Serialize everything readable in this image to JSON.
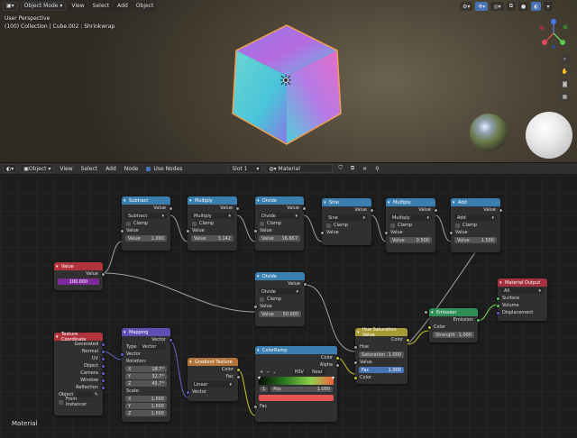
{
  "viewport": {
    "mode": "Object Mode",
    "menus": [
      "View",
      "Select",
      "Add",
      "Object"
    ],
    "info_line1": "User Perspective",
    "info_line2": "(100) Collection | Cube.002 : Shrinkwrap"
  },
  "node_editor": {
    "object_label": "Object",
    "menus": [
      "View",
      "Select",
      "Add",
      "Node"
    ],
    "use_nodes": "Use Nodes",
    "slot": "Slot 1",
    "material": "Material",
    "footer": "Material"
  },
  "nodes": {
    "subtract": {
      "title": "Subtract",
      "out": "Value",
      "op": "Subtract",
      "clamp": "Clamp",
      "in": "Value",
      "field": "Value",
      "val": "1.000"
    },
    "multiply1": {
      "title": "Multiply",
      "out": "Value",
      "op": "Multiply",
      "clamp": "Clamp",
      "in": "Value",
      "field": "Value",
      "val": "3.142"
    },
    "divide1": {
      "title": "Divide",
      "out": "Value",
      "op": "Divide",
      "clamp": "Clamp",
      "in": "Value",
      "field": "Value",
      "val": "16.667"
    },
    "sine": {
      "title": "Sine",
      "out": "Value",
      "op": "Sine",
      "clamp": "Clamp",
      "in": "Value"
    },
    "multiply2": {
      "title": "Multiply",
      "out": "Value",
      "op": "Multiply",
      "clamp": "Clamp",
      "in": "Value",
      "field": "Value",
      "val": "0.500"
    },
    "add": {
      "title": "Add",
      "out": "Value",
      "op": "Add",
      "clamp": "Clamp",
      "in": "Value",
      "field": "Value",
      "val": "1.500"
    },
    "value": {
      "title": "Value",
      "out": "Value",
      "val": "100.000"
    },
    "divide2": {
      "title": "Divide",
      "out": "Value",
      "op": "Divide",
      "clamp": "Clamp",
      "in": "Value",
      "field": "Value",
      "val": "50.000"
    },
    "material_output": {
      "title": "Material Output",
      "target": "All",
      "surface": "Surface",
      "volume": "Volume",
      "displacement": "Displacement"
    },
    "emission": {
      "title": "Emission",
      "out": "Emission",
      "color": "Color",
      "strength": "Strength",
      "strength_val": "1.000"
    },
    "hsv": {
      "title": "Hue Saturation Value",
      "out": "Color",
      "hue": "Hue",
      "saturation": "Saturation",
      "sat_val": "1.000",
      "value": "Value",
      "fac": "Fac",
      "fac_val": "1.000",
      "color": "Color"
    },
    "texcoord": {
      "title": "Texture Coordinate",
      "outputs": [
        "Generated",
        "Normal",
        "UV",
        "Object",
        "Camera",
        "Window",
        "Reflection"
      ],
      "object": "Object",
      "instancer": "From Instancer"
    },
    "mapping": {
      "title": "Mapping",
      "out": "Vector",
      "type_label": "Type",
      "type_val": "Vector",
      "in_vector": "Vector",
      "rotation": "Rotation:",
      "rot": [
        [
          "X",
          "18.7°"
        ],
        [
          "Y",
          "32.7°"
        ],
        [
          "Z",
          "45.7°"
        ]
      ],
      "scale": "Scale:",
      "scl": [
        [
          "X",
          "1.000"
        ],
        [
          "Y",
          "1.000"
        ],
        [
          "Z",
          "1.000"
        ]
      ]
    },
    "gradient": {
      "title": "Gradient Texture",
      "color": "Color",
      "fac": "Fac",
      "type": "Linear",
      "vector": "Vector"
    },
    "colorramp": {
      "title": "ColorRamp",
      "color": "Color",
      "alpha": "Alpha",
      "mode": "HSV",
      "interp": "Near",
      "stop": "1",
      "pos_label": "Pos",
      "pos_val": "1.000",
      "fac": "Fac"
    }
  },
  "colors": {
    "ramp_swatch": "#e45555",
    "value_field": "#7f2a9c"
  }
}
